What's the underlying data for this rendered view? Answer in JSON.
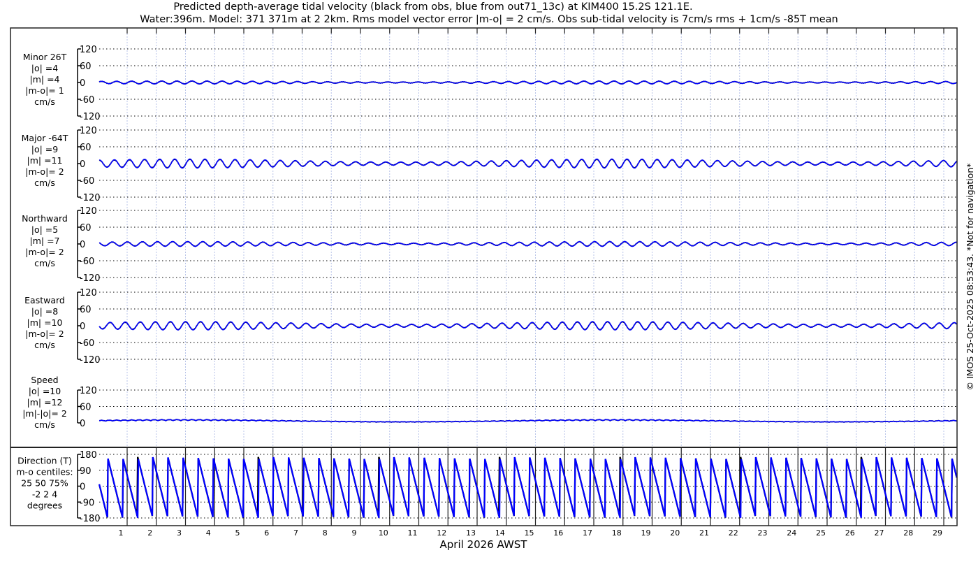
{
  "title": {
    "line1": "Predicted depth-average tidal velocity (black from obs, blue from out71_13c) at KIM400 15.2S 121.1E.",
    "line2": "Water:396m. Model: 371 371m at 2 2km. Rms model vector error |m-o| = 2 cm/s. Obs sub-tidal velocity is 7cm/s rms + 1cm/s -85T mean"
  },
  "copyright": "© IMOS 25-Oct-2025 08:53:43. *Not for navigation*",
  "colors": {
    "model": "#0000ff",
    "obs": "#000000",
    "grid": "#000000",
    "daygrid": "#b8c4e8"
  },
  "chart_data": {
    "type": "line",
    "xlabel": "April 2026 AWST",
    "x_ticks": [
      "1",
      "2",
      "3",
      "4",
      "5",
      "6",
      "7",
      "8",
      "9",
      "10",
      "11",
      "12",
      "13",
      "14",
      "15",
      "16",
      "17",
      "18",
      "19",
      "20",
      "21",
      "22",
      "23",
      "24",
      "25",
      "26",
      "27",
      "28",
      "29"
    ],
    "xlim_days": [
      0,
      29.5
    ],
    "series_legend": [
      {
        "name": "obs",
        "color": "#000000"
      },
      {
        "name": "out71_13c",
        "color": "#0000ff"
      }
    ],
    "panels": [
      {
        "id": "minor",
        "label": [
          "Minor 26T",
          "|o| =4",
          "|m| =4",
          "|m-o|= 1",
          "cm/s"
        ],
        "yticks": [
          "120",
          "60",
          "0",
          "-60",
          "-120"
        ],
        "ylim": [
          -120,
          120
        ],
        "amplitude": 5,
        "kind": "wave"
      },
      {
        "id": "major",
        "label": [
          "Major -64T",
          "|o| =9",
          "|m| =11",
          "|m-o|= 2",
          "cm/s"
        ],
        "yticks": [
          "120",
          "60",
          "0",
          "-60",
          "-120"
        ],
        "ylim": [
          -120,
          120
        ],
        "amplitude": 15,
        "kind": "wave"
      },
      {
        "id": "northward",
        "label": [
          "Northward",
          "|o| =5",
          "|m| =7",
          "|m-o|= 2",
          "cm/s"
        ],
        "yticks": [
          "120",
          "60",
          "0",
          "-60",
          "-120"
        ],
        "ylim": [
          -120,
          120
        ],
        "amplitude": 8,
        "kind": "wave"
      },
      {
        "id": "eastward",
        "label": [
          "Eastward",
          "|o| =8",
          "|m| =10",
          "|m-o|= 2",
          "cm/s"
        ],
        "yticks": [
          "120",
          "60",
          "0",
          "-60",
          "-120"
        ],
        "ylim": [
          -120,
          120
        ],
        "amplitude": 14,
        "kind": "wave"
      },
      {
        "id": "speed",
        "label": [
          "Speed",
          "|o| =10",
          "|m| =12",
          "|m|-|o|= 2",
          "cm/s"
        ],
        "yticks": [
          "120",
          "60",
          "0"
        ],
        "ylim": [
          0,
          120
        ],
        "amplitude": 12,
        "kind": "speed"
      },
      {
        "id": "direction",
        "label": [
          "Direction (T)",
          "m-o centiles:",
          "25  50  75%",
          "-2  2  4",
          "degrees"
        ],
        "yticks": [
          "180",
          "90",
          "0",
          "-90",
          "-180"
        ],
        "ylim": [
          -180,
          180
        ],
        "kind": "direction"
      }
    ],
    "tidal_period_hours": 12.42,
    "spring_neap_period_days": 14.77,
    "neap_days": [
      10.4,
      25.1
    ]
  }
}
